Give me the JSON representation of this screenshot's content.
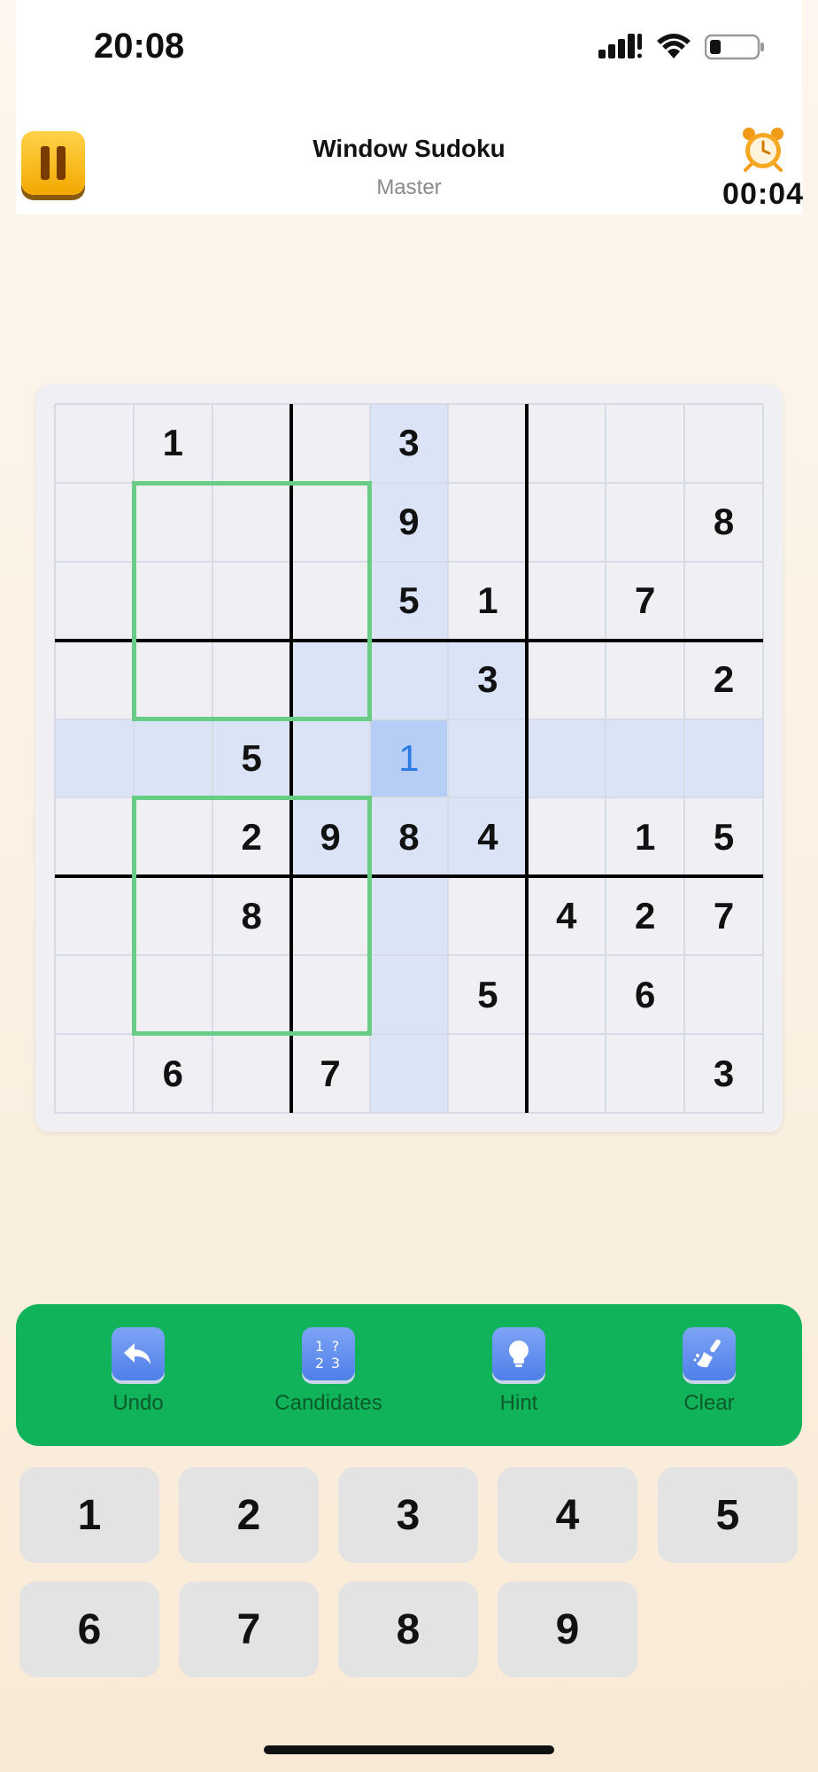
{
  "status": {
    "time": "20:08"
  },
  "header": {
    "title": "Window Sudoku",
    "difficulty": "Master",
    "timer": "00:04"
  },
  "board": {
    "grid": [
      [
        "",
        "1",
        "",
        "",
        "3",
        "",
        "",
        "",
        ""
      ],
      [
        "",
        "",
        "",
        "",
        "9",
        "",
        "",
        "",
        "8"
      ],
      [
        "",
        "",
        "",
        "",
        "5",
        "1",
        "",
        "7",
        ""
      ],
      [
        "",
        "",
        "",
        "",
        "",
        "3",
        "",
        "",
        "2"
      ],
      [
        "",
        "",
        "5",
        "",
        "1",
        "",
        "",
        "",
        ""
      ],
      [
        "",
        "",
        "2",
        "9",
        "8",
        "4",
        "",
        "1",
        "5"
      ],
      [
        "",
        "",
        "8",
        "",
        "",
        "",
        "4",
        "2",
        "7"
      ],
      [
        "",
        "",
        "",
        "",
        "",
        "5",
        "",
        "6",
        ""
      ],
      [
        "",
        "6",
        "",
        "7",
        "",
        "",
        "",
        "",
        "3"
      ]
    ],
    "selected": {
      "row": 5,
      "col": 5
    },
    "colors": {
      "highlight": "#dbe4f6",
      "selected": "#b6cdf5",
      "entered_digit": "#2a7be4",
      "window_border": "#68cc84"
    }
  },
  "toolbar": {
    "items": [
      {
        "label": "Undo",
        "icon": "undo-icon"
      },
      {
        "label": "Candidates",
        "icon": "candidates-icon"
      },
      {
        "label": "Hint",
        "icon": "lightbulb-icon"
      },
      {
        "label": "Clear",
        "icon": "brush-icon"
      }
    ]
  },
  "keypad": {
    "keys": [
      "1",
      "2",
      "3",
      "4",
      "5",
      "6",
      "7",
      "8",
      "9"
    ]
  }
}
